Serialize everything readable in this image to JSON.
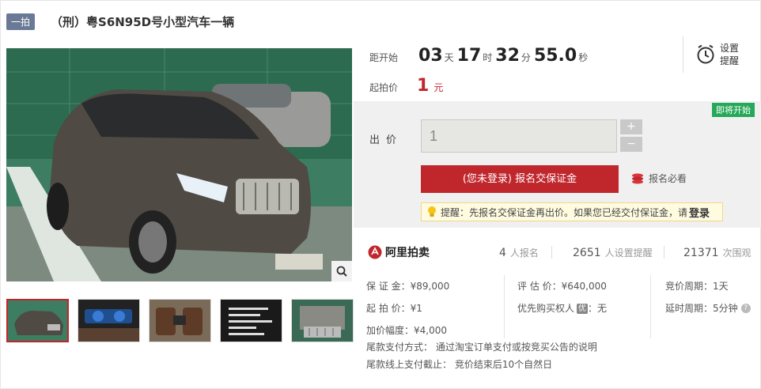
{
  "header": {
    "round_tag": "一拍",
    "title": "（刑）粤S6N95D号小型汽车一辆"
  },
  "countdown": {
    "label": "距开始",
    "days": "03",
    "days_unit": "天",
    "hours": "17",
    "hours_unit": "时",
    "minutes": "32",
    "minutes_unit": "分",
    "seconds": "55.0",
    "seconds_unit": "秒"
  },
  "reminder": {
    "line1": "设置",
    "line2": "提醒"
  },
  "start_price": {
    "label": "起拍价",
    "value": "1",
    "unit": "元"
  },
  "bid": {
    "status_badge": "即将开始",
    "label": "出价",
    "input_value": "1",
    "plus": "+",
    "minus": "−",
    "register_button": "(您未登录) 报名交保证金",
    "must_read": "报名必看",
    "tip_text": "提醒：先报名交保证金再出价。如果您已经交付保证金，请",
    "tip_login": "登录"
  },
  "stats": {
    "brand": "阿里拍卖",
    "registered_num": "4",
    "registered_label": "人报名",
    "reminders_num": "2651",
    "reminders_label": "人设置提醒",
    "views_num": "21371",
    "views_label": "次围观"
  },
  "details": {
    "deposit": "保 证 金：¥89,000",
    "appraisal": "评 估 价：¥640,000",
    "cycle": "竞价周期：1天",
    "starting": "起 拍 价：¥1",
    "priority_label": "优先购买权人",
    "priority_badge": "优",
    "priority_value": "：无",
    "extension": "延时周期：5分钟",
    "increment": "加价幅度：¥4,000"
  },
  "footer": {
    "payment_method": "尾款支付方式：  通过淘宝订单支付或按竞买公告的说明",
    "payment_deadline": "尾款线上支付截止：  竞价结束后10个自然日"
  },
  "colors": {
    "accent": "#c0272d",
    "tag_bg": "#6a7a96",
    "badge_green": "#26a85a"
  }
}
